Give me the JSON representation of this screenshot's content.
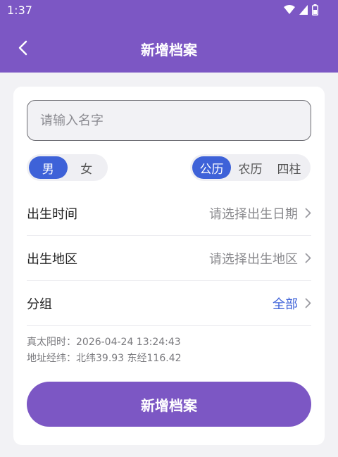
{
  "status_bar": {
    "time": "1:37"
  },
  "header": {
    "title": "新增档案"
  },
  "form": {
    "name_placeholder": "请输入名字",
    "gender_options": [
      "男",
      "女"
    ],
    "gender_selected": "男",
    "calendar_options": [
      "公历",
      "农历",
      "四柱"
    ],
    "calendar_selected": "公历",
    "rows": [
      {
        "label": "出生时间",
        "value": "请选择出生日期"
      },
      {
        "label": "出生地区",
        "value": "请选择出生地区"
      },
      {
        "label": "分组",
        "value": "全部"
      }
    ],
    "solar_time": "真太阳时：2026-04-24 13:24:43",
    "location": "地址经纬：北纬39.93 东经116.42",
    "submit_label": "新增档案"
  },
  "colors": {
    "primary": "#7c57c4",
    "accent": "#3e62d8",
    "background": "#f2f2f5"
  }
}
